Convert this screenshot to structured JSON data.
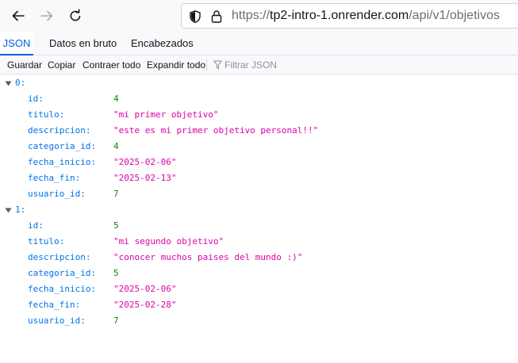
{
  "browser": {
    "url_prefix": "https://",
    "url_host": "tp2-intro-1.onrender.com",
    "url_path": "/api/v1/objetivos"
  },
  "tabs": [
    {
      "label": "JSON",
      "active": true
    },
    {
      "label": "Datos en bruto",
      "active": false
    },
    {
      "label": "Encabezados",
      "active": false
    }
  ],
  "json_toolbar": {
    "save": "Guardar",
    "copy": "Copiar",
    "collapse_all": "Contraer todo",
    "expand_all": "Expandir todo",
    "filter_placeholder": "Filtrar JSON"
  },
  "items": [
    {
      "index_label": "0:",
      "fields": [
        {
          "key": "id:",
          "value": "4",
          "type": "num"
        },
        {
          "key": "titulo:",
          "value": "\"mi primer objetivo\"",
          "type": "str"
        },
        {
          "key": "descripcion:",
          "value": "\"este es mi primer objetivo personal!!\"",
          "type": "str"
        },
        {
          "key": "categoria_id:",
          "value": "4",
          "type": "num"
        },
        {
          "key": "fecha_inicio:",
          "value": "\"2025-02-06\"",
          "type": "str"
        },
        {
          "key": "fecha_fin:",
          "value": "\"2025-02-13\"",
          "type": "str"
        },
        {
          "key": "usuario_id:",
          "value": "7",
          "type": "num"
        }
      ]
    },
    {
      "index_label": "1:",
      "fields": [
        {
          "key": "id:",
          "value": "5",
          "type": "num"
        },
        {
          "key": "titulo:",
          "value": "\"mi segundo objetivo\"",
          "type": "str"
        },
        {
          "key": "descripcion:",
          "value": "\"conocer muchos paises del mundo :)\"",
          "type": "str"
        },
        {
          "key": "categoria_id:",
          "value": "5",
          "type": "num"
        },
        {
          "key": "fecha_inicio:",
          "value": "\"2025-02-06\"",
          "type": "str"
        },
        {
          "key": "fecha_fin:",
          "value": "\"2025-02-28\"",
          "type": "str"
        },
        {
          "key": "usuario_id:",
          "value": "7",
          "type": "num"
        }
      ]
    }
  ],
  "colors": {
    "key": "#0074e8",
    "number": "#058b00",
    "string": "#dd00a9",
    "accent": "#0060df"
  },
  "icons": {
    "back": "arrow-left-icon",
    "forward": "arrow-right-icon",
    "reload": "reload-icon",
    "tracking": "shield-icon",
    "security": "lock-icon",
    "filter": "funnel-icon",
    "expander": "triangle-down-icon"
  }
}
